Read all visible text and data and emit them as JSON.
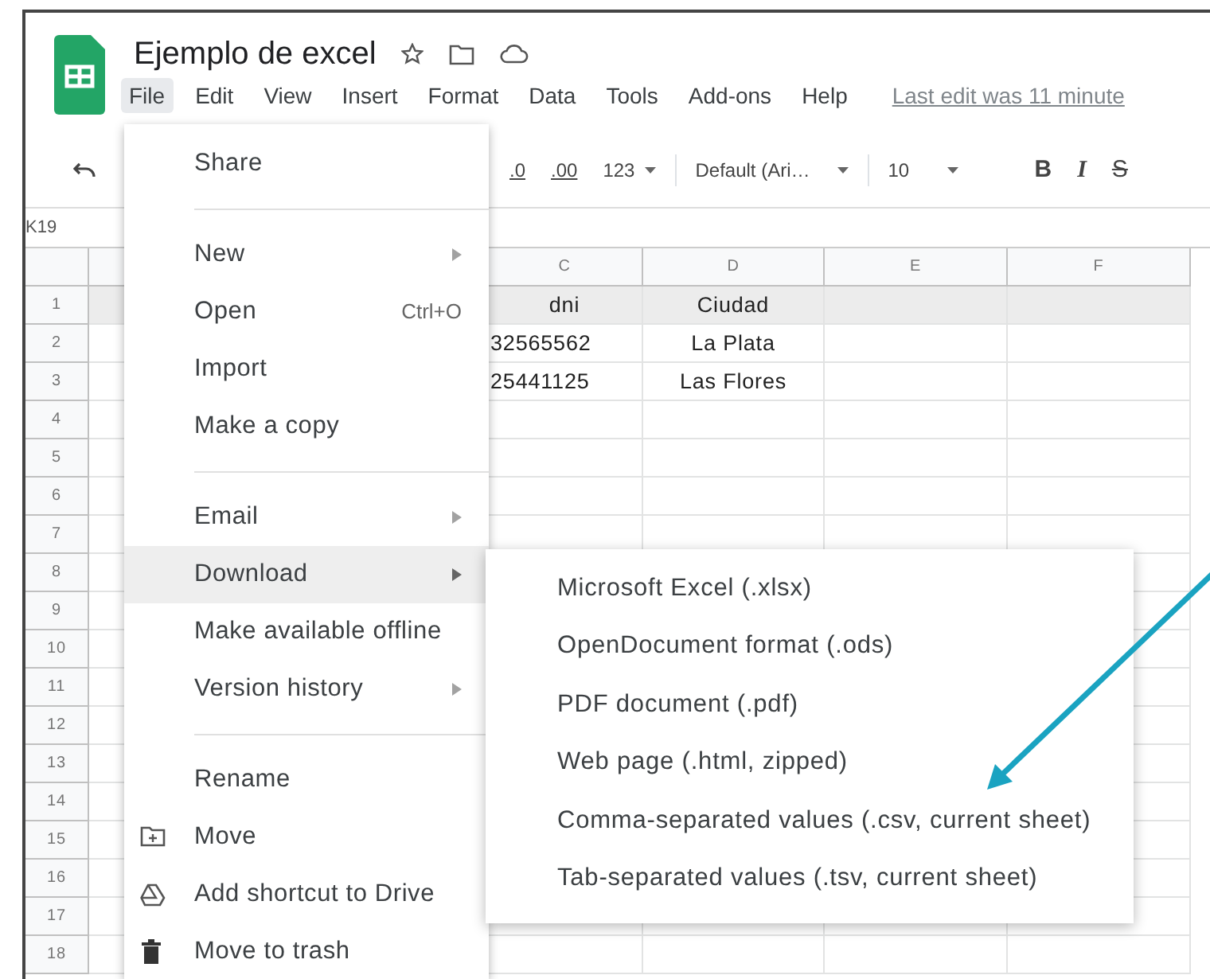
{
  "document": {
    "title": "Ejemplo de excel",
    "last_edit": "Last edit was 11 minute"
  },
  "menu_bar": [
    {
      "label": "File",
      "selected": true
    },
    {
      "label": "Edit",
      "selected": false
    },
    {
      "label": "View",
      "selected": false
    },
    {
      "label": "Insert",
      "selected": false
    },
    {
      "label": "Format",
      "selected": false
    },
    {
      "label": "Data",
      "selected": false
    },
    {
      "label": "Tools",
      "selected": false
    },
    {
      "label": "Add-ons",
      "selected": false
    },
    {
      "label": "Help",
      "selected": false
    }
  ],
  "toolbar": {
    "decimal_buttons": [
      ".0",
      ".00"
    ],
    "number_format": "123",
    "font": "Default (Ari…",
    "font_size": "10",
    "style_buttons": [
      "B",
      "I",
      "S"
    ]
  },
  "name_box": "K19",
  "sheet": {
    "columns": [
      "C",
      "D",
      "E",
      "F"
    ],
    "rows": [
      {
        "number": "1",
        "shaded": true,
        "cells": [
          "dni",
          "Ciudad",
          "",
          ""
        ]
      },
      {
        "number": "2",
        "shaded": false,
        "cells": [
          "32565562",
          "La Plata",
          "",
          ""
        ]
      },
      {
        "number": "3",
        "shaded": false,
        "cells": [
          "25441125",
          "Las Flores",
          "",
          ""
        ]
      },
      {
        "number": "4",
        "shaded": false,
        "cells": [
          "",
          "",
          "",
          ""
        ]
      },
      {
        "number": "5",
        "shaded": false,
        "cells": [
          "",
          "",
          "",
          ""
        ]
      },
      {
        "number": "6",
        "shaded": false,
        "cells": [
          "",
          "",
          "",
          ""
        ]
      },
      {
        "number": "7",
        "shaded": false,
        "cells": [
          "",
          "",
          "",
          ""
        ]
      },
      {
        "number": "8",
        "shaded": false,
        "cells": [
          "",
          "",
          "",
          ""
        ]
      },
      {
        "number": "9",
        "shaded": false,
        "cells": [
          "",
          "",
          "",
          ""
        ]
      },
      {
        "number": "10",
        "shaded": false,
        "cells": [
          "",
          "",
          "",
          ""
        ]
      },
      {
        "number": "11",
        "shaded": false,
        "cells": [
          "",
          "",
          "",
          ""
        ]
      },
      {
        "number": "12",
        "shaded": false,
        "cells": [
          "",
          "",
          "",
          ""
        ]
      },
      {
        "number": "13",
        "shaded": false,
        "cells": [
          "",
          "",
          "",
          ""
        ]
      },
      {
        "number": "14",
        "shaded": false,
        "cells": [
          "",
          "",
          "",
          ""
        ]
      },
      {
        "number": "15",
        "shaded": false,
        "cells": [
          "",
          "",
          "",
          ""
        ]
      },
      {
        "number": "16",
        "shaded": false,
        "cells": [
          "",
          "",
          "",
          ""
        ]
      },
      {
        "number": "17",
        "shaded": false,
        "cells": [
          "",
          "",
          "",
          ""
        ]
      },
      {
        "number": "18",
        "shaded": false,
        "cells": [
          "",
          "",
          "",
          ""
        ]
      }
    ]
  },
  "file_menu": [
    {
      "kind": "item",
      "label": "Share",
      "submenu": false,
      "selected": false
    },
    {
      "kind": "separator"
    },
    {
      "kind": "item",
      "label": "New",
      "submenu": true,
      "selected": false
    },
    {
      "kind": "item",
      "label": "Open",
      "shortcut": "Ctrl+O",
      "submenu": false,
      "selected": false
    },
    {
      "kind": "item",
      "label": "Import",
      "submenu": false,
      "selected": false
    },
    {
      "kind": "item",
      "label": "Make a copy",
      "submenu": false,
      "selected": false
    },
    {
      "kind": "separator"
    },
    {
      "kind": "item",
      "label": "Email",
      "submenu": true,
      "selected": false
    },
    {
      "kind": "item",
      "label": "Download",
      "submenu": true,
      "selected": true
    },
    {
      "kind": "item",
      "label": "Make available offline",
      "submenu": false,
      "selected": false
    },
    {
      "kind": "item",
      "label": "Version history",
      "submenu": true,
      "selected": false
    },
    {
      "kind": "separator"
    },
    {
      "kind": "item",
      "label": "Rename",
      "submenu": false,
      "selected": false
    },
    {
      "kind": "icon_item",
      "label": "Move",
      "submenu": false,
      "selected": false
    },
    {
      "kind": "icon_item",
      "label": "Add shortcut to Drive",
      "submenu": false,
      "selected": false
    },
    {
      "kind": "icon_item",
      "label": "Move to trash",
      "submenu": false,
      "selected": false
    }
  ],
  "download_menu": [
    "Microsoft Excel (.xlsx)",
    "OpenDocument format (.ods)",
    "PDF document (.pdf)",
    "Web page (.html, zipped)",
    "Comma-separated values (.csv, current sheet)",
    "Tab-separated values (.tsv, current sheet)"
  ]
}
